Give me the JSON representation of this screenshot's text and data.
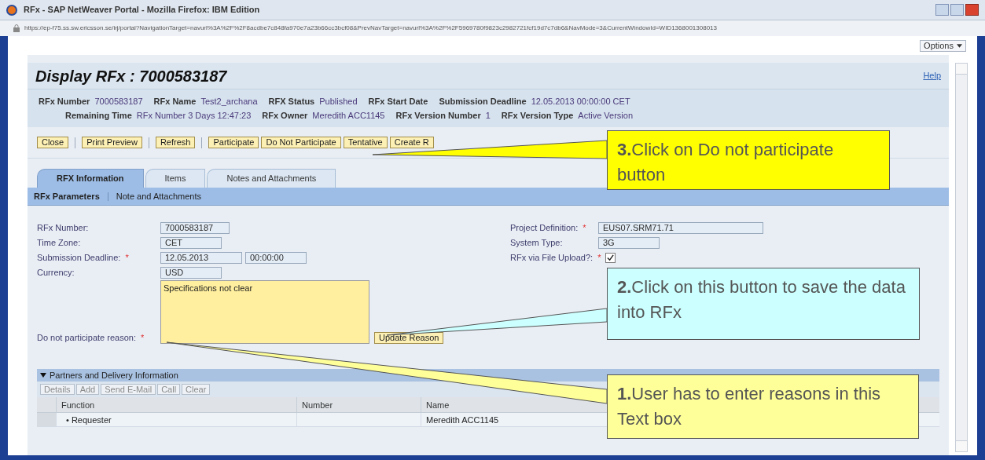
{
  "window": {
    "title": "RFx - SAP NetWeaver Portal - Mozilla Firefox: IBM Edition",
    "url": "https://ep-f75.ss.sw.ericsson.se/irj/portal?NavigationTarget=navurl%3A%2F%2F8acdbe7c848fa970e7a23b66cc3bcf08&PrevNavTarget=navurl%3A%2F%2F5969780f9823c2982721fcf19d7c7db6&NavMode=3&CurrentWindowId=WID1368001308013"
  },
  "options_button": "Options",
  "required_marker": "*",
  "page_title": "Display RFx : 7000583187",
  "help_link": "Help",
  "header_rows": [
    [
      {
        "label": "RFx Number",
        "value": "7000583187"
      },
      {
        "label": "RFx Name",
        "value": "Test2_archana"
      },
      {
        "label": "RFX Status",
        "value": "Published"
      },
      {
        "label": "RFx Start Date"
      },
      {
        "label": "Submission Deadline",
        "value": "12.05.2013 00:00:00 CET"
      }
    ],
    [
      {
        "label": "Remaining Time",
        "value": "RFx Number 3 Days 12:47:23"
      },
      {
        "label": "RFx Owner",
        "value": "Meredith ACC1145"
      },
      {
        "label": "RFx Version Number",
        "value": "1"
      },
      {
        "label": "RFx Version Type",
        "value": "Active Version"
      }
    ]
  ],
  "toolbar_groups": [
    [
      "Close"
    ],
    [
      "Print Preview"
    ],
    [
      "Refresh"
    ],
    [
      "Participate",
      "Do Not Participate",
      "Tentative",
      "Create R"
    ]
  ],
  "tabs": [
    {
      "label": "RFX Information",
      "selected": true
    },
    {
      "label": "Items",
      "selected": false
    },
    {
      "label": "Notes and Attachments",
      "selected": false
    }
  ],
  "subtabs": [
    {
      "label": "RFx Parameters",
      "selected": true
    },
    {
      "label": "Note and Attachments",
      "selected": false
    }
  ],
  "form_left": [
    {
      "kind": "input",
      "label": "RFx Number:",
      "required": false,
      "values": [
        "7000583187"
      ]
    },
    {
      "kind": "input",
      "label": "Time Zone:",
      "required": false,
      "values": [
        "CET"
      ]
    },
    {
      "kind": "input",
      "label": "Submission Deadline:",
      "required": true,
      "values": [
        "12.05.2013",
        "00:00:00"
      ]
    },
    {
      "kind": "input",
      "label": "Currency:",
      "required": false,
      "values": [
        "USD"
      ]
    },
    {
      "kind": "textarea",
      "label": "Do not participate reason:",
      "required": true,
      "values": [
        "Specifications not clear"
      ],
      "button": "Update Reason"
    }
  ],
  "form_right": [
    {
      "kind": "input",
      "label": "Project Definition:",
      "required": true,
      "values": [
        "EUS07.SRM71.71"
      ]
    },
    {
      "kind": "input",
      "label": "System Type:",
      "required": false,
      "values": [
        "3G"
      ]
    },
    {
      "kind": "checkbox",
      "label": "RFx via File Upload?:",
      "required": true,
      "checked": true
    }
  ],
  "partners": {
    "title": "Partners and Delivery Information",
    "expanded": true,
    "buttons": [
      "Details",
      "Add",
      "Send E-Mail",
      "Call",
      "Clear"
    ],
    "columns": [
      "Function",
      "Number",
      "Name"
    ],
    "bullet": "•",
    "rows": [
      {
        "cells": [
          "Requester",
          "",
          "Meredith ACC1145"
        ]
      }
    ]
  },
  "callouts": [
    {
      "number": "3.",
      "text": "Click on Do not participate button",
      "color": "#ffff00"
    },
    {
      "number": "2.",
      "text": "Click on this button to save the data into RFx",
      "color": "#ccffff"
    },
    {
      "number": "1.",
      "text": "User has to enter reasons in this Text box",
      "color": "#ffff99"
    }
  ]
}
